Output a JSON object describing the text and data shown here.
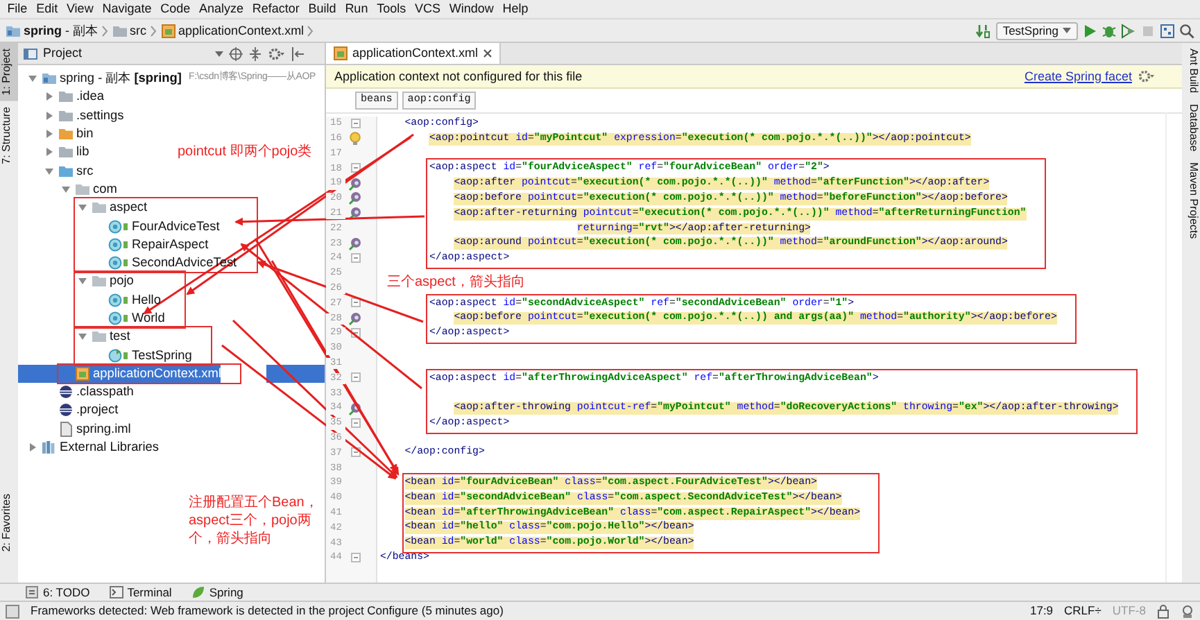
{
  "menu": [
    "File",
    "Edit",
    "View",
    "Navigate",
    "Code",
    "Analyze",
    "Refactor",
    "Build",
    "Run",
    "Tools",
    "VCS",
    "Window",
    "Help"
  ],
  "nav_bar": {
    "breadcrumbs": [
      {
        "text": "**spring** - 副本",
        "kind": "module"
      },
      {
        "text": "src",
        "kind": "folder"
      },
      {
        "text": "applicationContext.xml",
        "kind": "xml"
      }
    ],
    "run_config": "TestSpring"
  },
  "left_tool_tabs": [
    {
      "label": "1: Project",
      "selected": true
    },
    {
      "label": "7: Structure",
      "selected": false
    }
  ],
  "left_bottom_tabs": [
    {
      "label": "2: Favorites",
      "selected": false
    }
  ],
  "project_panel": {
    "title": "Project",
    "tree": [
      {
        "label": "spring - 副本 **[spring]**",
        "path": "F:\\csdn博客\\Spring——从AOP",
        "kind": "module",
        "expanded": true,
        "selected": false,
        "boxed": false,
        "children": [
          {
            "label": ".idea",
            "kind": "folder",
            "expanded": false,
            "selected": false,
            "boxed": false
          },
          {
            "label": ".settings",
            "kind": "folder",
            "expanded": false,
            "selected": false,
            "boxed": false
          },
          {
            "label": "bin",
            "kind": "excluded-folder",
            "expanded": false,
            "selected": false,
            "boxed": false
          },
          {
            "label": "lib",
            "kind": "folder",
            "expanded": false,
            "selected": false,
            "boxed": false
          },
          {
            "label": "src",
            "kind": "source-folder",
            "expanded": true,
            "selected": false,
            "boxed": false,
            "children": [
              {
                "label": "com",
                "kind": "package",
                "expanded": true,
                "selected": false,
                "boxed": false,
                "children": [
                  {
                    "label": "aspect",
                    "kind": "package",
                    "expanded": true,
                    "selected": false,
                    "boxed": true,
                    "children": [
                      {
                        "label": "FourAdviceTest",
                        "kind": "class",
                        "selected": false,
                        "boxed": false
                      },
                      {
                        "label": "RepairAspect",
                        "kind": "class",
                        "selected": false,
                        "boxed": false
                      },
                      {
                        "label": "SecondAdviceTest",
                        "kind": "class",
                        "selected": false,
                        "boxed": false
                      }
                    ]
                  },
                  {
                    "label": "pojo",
                    "kind": "package",
                    "expanded": true,
                    "selected": false,
                    "boxed": true,
                    "children": [
                      {
                        "label": "Hello",
                        "kind": "class",
                        "selected": false,
                        "boxed": false
                      },
                      {
                        "label": "World",
                        "kind": "class",
                        "selected": false,
                        "boxed": false
                      }
                    ]
                  },
                  {
                    "label": "test",
                    "kind": "package",
                    "expanded": true,
                    "selected": false,
                    "boxed": true,
                    "children": [
                      {
                        "label": "TestSpring",
                        "kind": "test-class",
                        "selected": false,
                        "boxed": false
                      }
                    ]
                  }
                ]
              },
              {
                "label": "applicationContext.xml",
                "kind": "xml",
                "selected": true,
                "boxed": true
              }
            ]
          },
          {
            "label": ".classpath",
            "kind": "eclipse-file",
            "selected": false,
            "boxed": false
          },
          {
            "label": ".project",
            "kind": "eclipse-file",
            "selected": false,
            "boxed": false
          },
          {
            "label": "spring.iml",
            "kind": "iml",
            "selected": false,
            "boxed": false
          }
        ]
      },
      {
        "label": "External Libraries",
        "kind": "libraries",
        "expanded": false,
        "selected": false,
        "boxed": false
      }
    ]
  },
  "editor": {
    "tab": "applicationContext.xml",
    "notification": {
      "text": "Application context not configured for this file",
      "link": "Create Spring facet"
    },
    "breadcrumbs": [
      "beans",
      "aop:config"
    ],
    "code": [
      {
        "boxed": false,
        "lines": [
          {
            "number": "15",
            "text": "    <aop:config>",
            "highlighted": false,
            "kind": "fold"
          },
          {
            "number": "16",
            "text": "        <aop:pointcut id=\"myPointcut\" expression=\"execution(* com.pojo.*.*(..))\"></aop:pointcut>",
            "highlighted": true,
            "kind": "bulb"
          },
          {
            "number": "17"
          }
        ]
      },
      {
        "boxed": true,
        "lines": [
          {
            "number": "18",
            "text": "        <aop:aspect id=\"fourAdviceAspect\" ref=\"fourAdviceBean\" order=\"2\">",
            "highlighted": false,
            "kind": "fold"
          },
          {
            "number": "19",
            "text": "            <aop:after pointcut=\"execution(* com.pojo.*.*(..))\" method=\"afterFunction\"></aop:after>",
            "highlighted": true,
            "kind": "advice"
          },
          {
            "number": "20",
            "text": "            <aop:before pointcut=\"execution(* com.pojo.*.*(..))\" method=\"beforeFunction\"></aop:before>",
            "highlighted": true,
            "kind": "advice"
          },
          {
            "number": "21",
            "text": "            <aop:after-returning pointcut=\"execution(* com.pojo.*.*(..))\" method=\"afterReturningFunction\"",
            "highlighted": true,
            "kind": "advice"
          },
          {
            "number": "22",
            "text": "                                returning=\"rvt\"></aop:after-returning>",
            "highlighted": true
          },
          {
            "number": "23",
            "text": "            <aop:around pointcut=\"execution(* com.pojo.*.*(..))\" method=\"aroundFunction\"></aop:around>",
            "highlighted": true,
            "kind": "advice"
          },
          {
            "number": "24",
            "text": "        </aop:aspect>",
            "highlighted": false,
            "kind": "fold"
          }
        ]
      },
      {
        "boxed": false,
        "lines": [
          {
            "number": "25"
          },
          {
            "number": "26"
          }
        ]
      },
      {
        "boxed": true,
        "lines": [
          {
            "number": "27",
            "text": "        <aop:aspect id=\"secondAdviceAspect\" ref=\"secondAdviceBean\" order=\"1\">",
            "highlighted": false,
            "kind": "fold"
          },
          {
            "number": "28",
            "text": "            <aop:before pointcut=\"execution(* com.pojo.*.*(..)) and args(aa)\" method=\"authority\"></aop:before>",
            "highlighted": true,
            "kind": "advice"
          },
          {
            "number": "29",
            "text": "        </aop:aspect>",
            "highlighted": false,
            "kind": "fold"
          }
        ]
      },
      {
        "boxed": false,
        "lines": [
          {
            "number": "30"
          },
          {
            "number": "31"
          }
        ]
      },
      {
        "boxed": true,
        "lines": [
          {
            "number": "32",
            "text": "        <aop:aspect id=\"afterThrowingAdviceAspect\" ref=\"afterThrowingAdviceBean\">",
            "highlighted": false,
            "kind": "fold"
          },
          {
            "number": "33"
          },
          {
            "number": "34",
            "text": "            <aop:after-throwing pointcut-ref=\"myPointcut\" method=\"doRecoveryActions\" throwing=\"ex\"></aop:after-throwing>",
            "highlighted": true,
            "kind": "advice"
          },
          {
            "number": "35",
            "text": "        </aop:aspect>",
            "highlighted": false,
            "kind": "fold"
          }
        ]
      },
      {
        "boxed": false,
        "lines": [
          {
            "number": "36"
          },
          {
            "number": "37",
            "text": "    </aop:config>",
            "highlighted": false,
            "kind": "fold"
          },
          {
            "number": "38"
          }
        ]
      },
      {
        "boxed": true,
        "lines": [
          {
            "number": "39",
            "text": "    <bean id=\"fourAdviceBean\" class=\"com.aspect.FourAdviceTest\"></bean>",
            "highlighted": true
          },
          {
            "number": "40",
            "text": "    <bean id=\"secondAdviceBean\" class=\"com.aspect.SecondAdviceTest\"></bean>",
            "highlighted": true
          },
          {
            "number": "41",
            "text": "    <bean id=\"afterThrowingAdviceBean\" class=\"com.aspect.RepairAspect\"></bean>",
            "highlighted": true
          },
          {
            "number": "42",
            "text": "    <bean id=\"hello\" class=\"com.pojo.Hello\"></bean>",
            "highlighted": true
          },
          {
            "number": "43",
            "text": "    <bean id=\"world\" class=\"com.pojo.World\"></bean>",
            "highlighted": true
          }
        ]
      },
      {
        "boxed": false,
        "lines": [
          {
            "number": "44",
            "text": "</beans>",
            "highlighted": false,
            "kind": "fold"
          }
        ]
      }
    ]
  },
  "right_tool_tabs": [
    "Ant Build",
    "Database",
    "Maven Projects"
  ],
  "annotations": [
    {
      "text": "pointcut 即两个pojo类"
    },
    {
      "text": "三个aspect，箭头指向"
    },
    {
      "text": "注册配置五个Bean，aspect三个，pojo两个，箭头指向"
    }
  ],
  "bottom_tool_tabs": [
    {
      "label": "6: TODO",
      "kind": "todo"
    },
    {
      "label": "Terminal",
      "kind": "terminal"
    },
    {
      "label": "Spring",
      "kind": "spring"
    }
  ],
  "status_bar": {
    "message": "Frameworks detected: Web framework is detected in the project Configure (5 minutes ago)",
    "position": "17:9",
    "line_separator": "CRLF÷",
    "encoding": "UTF-8"
  }
}
